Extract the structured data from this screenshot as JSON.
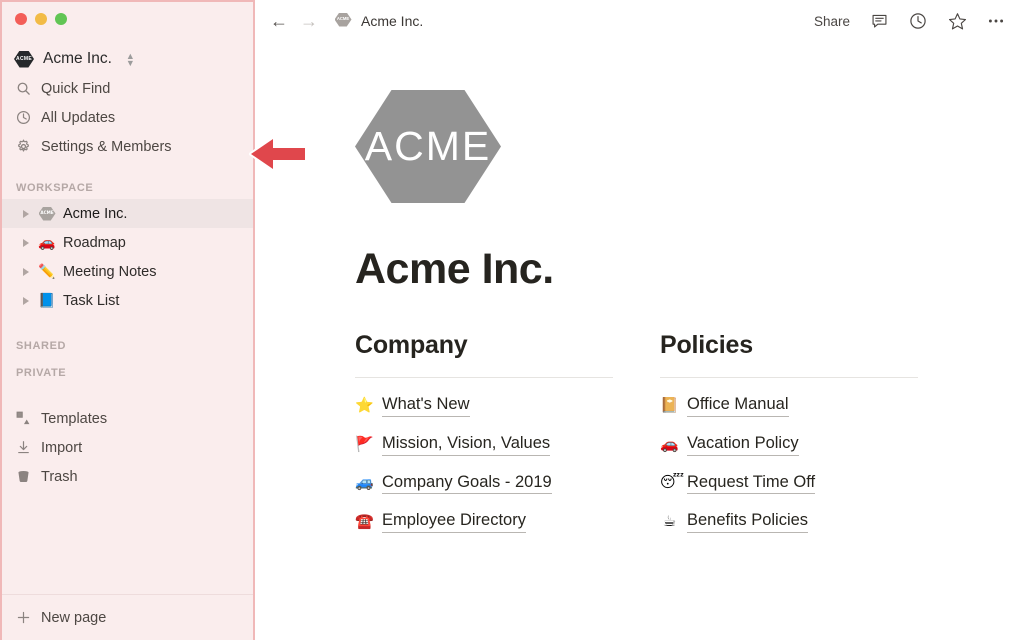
{
  "window": {
    "traffic_lights": [
      {
        "name": "close",
        "color": "#f35e58"
      },
      {
        "name": "minimize",
        "color": "#f2bb46"
      },
      {
        "name": "maximize",
        "color": "#61c554"
      }
    ]
  },
  "sidebar": {
    "workspace_switcher": {
      "badge_text": "ACME",
      "name": "Acme Inc.",
      "chevron": "⌃⌄"
    },
    "nav_items": [
      {
        "icon": "search-icon",
        "label": "Quick Find"
      },
      {
        "icon": "clock-icon",
        "label": "All Updates"
      },
      {
        "icon": "gear-icon",
        "label": "Settings & Members"
      }
    ],
    "sections": [
      {
        "label": "WORKSPACE",
        "pages": [
          {
            "emoji": "",
            "badge": "ACME",
            "label": "Acme Inc.",
            "selected": true
          },
          {
            "emoji": "🚗",
            "label": "Roadmap",
            "selected": false
          },
          {
            "emoji": "✏️",
            "label": "Meeting Notes",
            "selected": false
          },
          {
            "emoji": "📘",
            "label": "Task List",
            "selected": false
          }
        ]
      },
      {
        "label": "SHARED",
        "pages": []
      },
      {
        "label": "PRIVATE",
        "pages": []
      }
    ],
    "utility_items": [
      {
        "icon": "templates-icon",
        "label": "Templates"
      },
      {
        "icon": "import-icon",
        "label": "Import"
      },
      {
        "icon": "trash-icon",
        "label": "Trash"
      }
    ],
    "footer": {
      "icon": "plus-icon",
      "label": "New page"
    }
  },
  "topbar": {
    "back_icon": "arrow-left-icon",
    "forward_icon": "arrow-right-icon",
    "breadcrumb": {
      "badge_text": "ACME",
      "label": "Acme Inc."
    },
    "share_label": "Share",
    "icons": [
      {
        "name": "comment-icon"
      },
      {
        "name": "history-clock-icon"
      },
      {
        "name": "star-icon"
      },
      {
        "name": "more-options-icon"
      }
    ]
  },
  "main": {
    "logo": {
      "text": "ACME",
      "color": "#939393"
    },
    "title": "Acme Inc.",
    "columns": [
      {
        "title": "Company",
        "links": [
          {
            "emoji": "⭐",
            "label": "What's New"
          },
          {
            "emoji": "🚩",
            "label": "Mission, Vision, Values"
          },
          {
            "emoji": "🚙",
            "label": "Company Goals - 2019"
          },
          {
            "emoji": "☎️",
            "label": "Employee Directory"
          }
        ]
      },
      {
        "title": "Policies",
        "links": [
          {
            "emoji": "📔",
            "label": "Office Manual"
          },
          {
            "emoji": "🚗",
            "label": "Vacation Policy"
          },
          {
            "emoji": "😴",
            "label": "Request Time Off"
          },
          {
            "emoji": "☕",
            "label": "Benefits Policies"
          }
        ]
      }
    ]
  },
  "annotation": {
    "arrow": {
      "direction": "left",
      "color": "#e0474c"
    }
  }
}
